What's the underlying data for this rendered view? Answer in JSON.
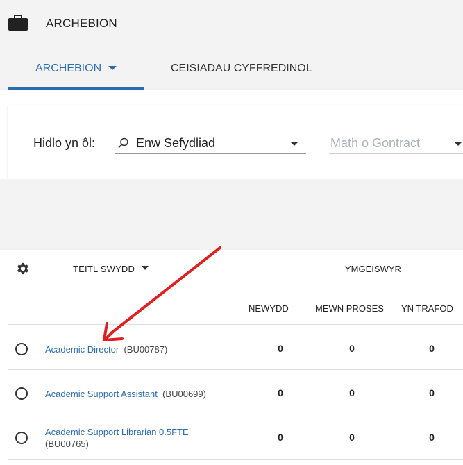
{
  "app": {
    "title": "ARCHEBION",
    "icon": "briefcase-icon"
  },
  "tabs": [
    {
      "label": "ARCHEBION",
      "active": true
    },
    {
      "label": "CEISIADAU CYFFREDINOL",
      "active": false
    }
  ],
  "filter": {
    "label": "Hidlo yn ôl:",
    "organisation_value": "Enw Sefydliad",
    "contract_placeholder": "Math o Gontract"
  },
  "table": {
    "columns": {
      "title": "TEITL SWYDD",
      "applicants_group": "YMGEISWYR",
      "new": "NEWYDD",
      "in_process": "MEWN PROSES",
      "discussing": "YN TRAFOD"
    },
    "rows": [
      {
        "title": "Academic Director",
        "code": "(BU00787)",
        "new": "0",
        "in_process": "0",
        "discussing": "0"
      },
      {
        "title": "Academic Support Assistant",
        "code": "(BU00699)",
        "new": "0",
        "in_process": "0",
        "discussing": "0"
      },
      {
        "title": "Academic Support Librarian 0.5FTE",
        "code": "(BU00765)",
        "new": "0",
        "in_process": "0",
        "discussing": "0"
      }
    ]
  },
  "colors": {
    "accent": "#2b6cb0",
    "annotation": "#e02020",
    "background": "#f3f3f3"
  }
}
